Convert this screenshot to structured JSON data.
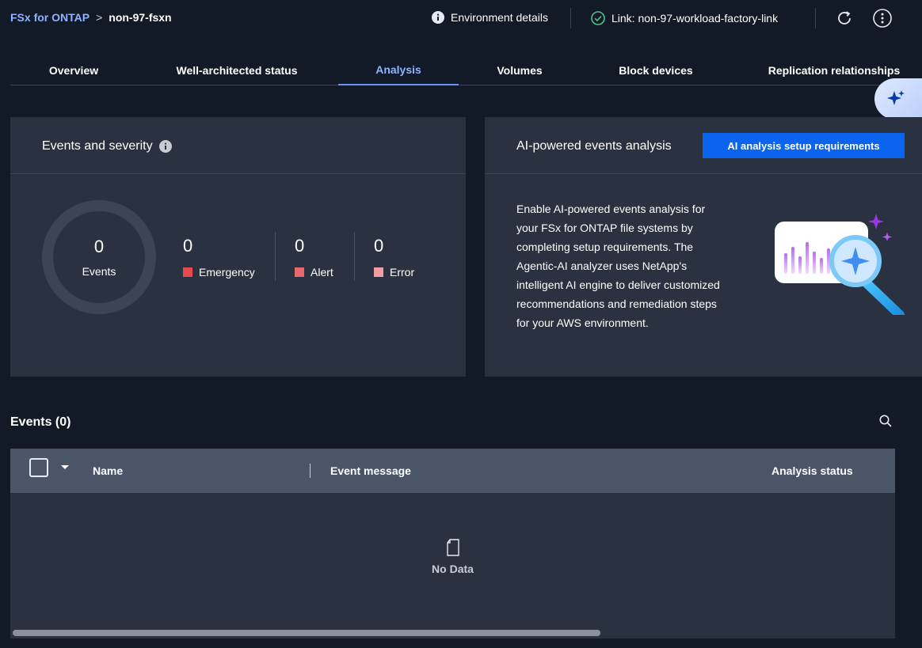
{
  "breadcrumb": {
    "root": "FSx for ONTAP",
    "separator": ">",
    "current": "non-97-fsxn"
  },
  "header": {
    "environment_details": "Environment details",
    "link_label": "Link: non-97-workload-factory-link"
  },
  "tabs": [
    {
      "label": "Overview"
    },
    {
      "label": "Well-architected status"
    },
    {
      "label": "Analysis"
    },
    {
      "label": "Volumes"
    },
    {
      "label": "Block devices"
    },
    {
      "label": "Replication relationships"
    }
  ],
  "events_card": {
    "title": "Events and severity",
    "total": "0",
    "total_label": "Events",
    "stats": [
      {
        "value": "0",
        "label": "Emergency",
        "color": "#e5484d"
      },
      {
        "value": "0",
        "label": "Alert",
        "color": "#e5696c"
      },
      {
        "value": "0",
        "label": "Error",
        "color": "#f19ea0"
      }
    ]
  },
  "ai_card": {
    "title": "AI-powered events analysis",
    "button": "AI analysis setup requirements",
    "description": "Enable AI-powered events analysis for your FSx for ONTAP file systems by completing setup requirements. The Agentic-AI analyzer uses NetApp's intelligent AI engine to deliver customized recommendations and remediation steps for your AWS environment."
  },
  "events_table": {
    "title": "Events (0)",
    "columns": [
      "Name",
      "Event message",
      "Analysis status"
    ],
    "empty_text": "No Data"
  },
  "colors": {
    "accent": "#0a64f0",
    "link": "#8fb3ff",
    "success": "#4cc38a"
  }
}
